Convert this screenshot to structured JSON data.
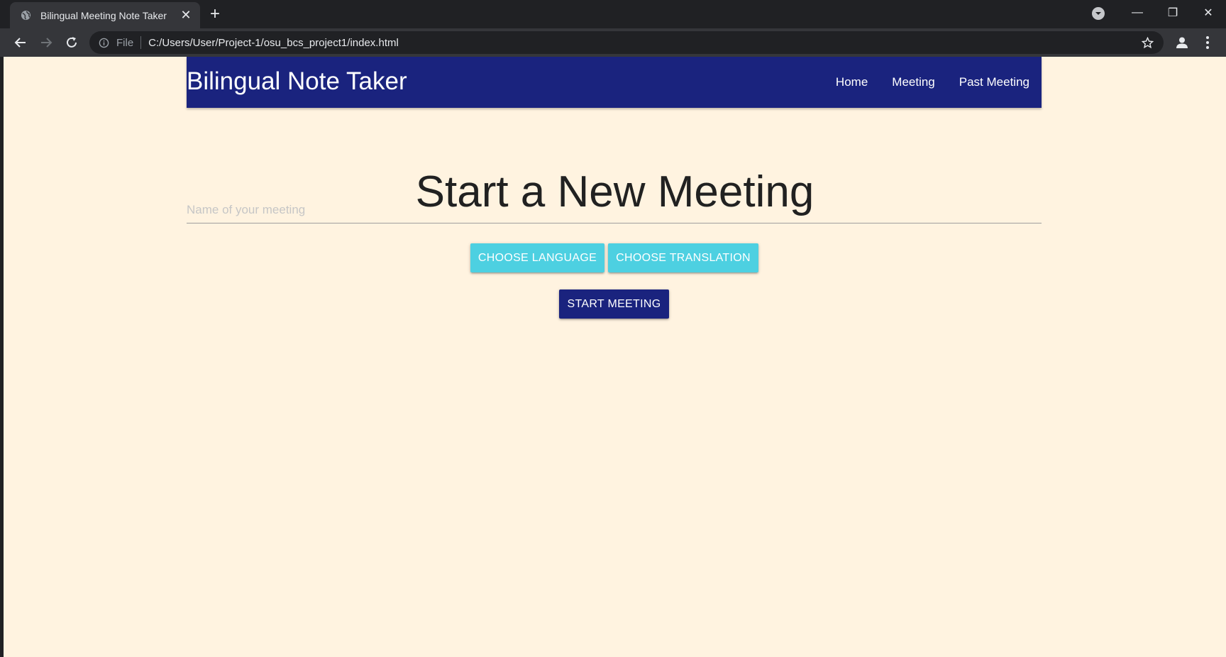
{
  "browser": {
    "tab_title": "Bilingual Meeting Note Taker",
    "tab_close": "✕",
    "new_tab": "+",
    "scheme_label": "File",
    "url": "C:/Users/User/Project-1/osu_bcs_project1/index.html",
    "window_controls": {
      "minimize": "—",
      "restore": "❐",
      "close": "✕"
    }
  },
  "nav": {
    "brand": "Bilingual Note Taker",
    "links": [
      "Home",
      "Meeting",
      "Past Meeting"
    ]
  },
  "main": {
    "heading": "Start a New Meeting",
    "meeting_name": {
      "value": "",
      "placeholder": "Name of your meeting"
    },
    "choose_language_label": "CHOOSE LANGUAGE",
    "choose_translation_label": "CHOOSE TRANSLATION",
    "start_meeting_label": "START MEETING"
  },
  "colors": {
    "navbar": "#1a237e",
    "page_background": "#fff3e0",
    "accent_button": "#4dd0e1",
    "primary_button": "#1a237e"
  }
}
